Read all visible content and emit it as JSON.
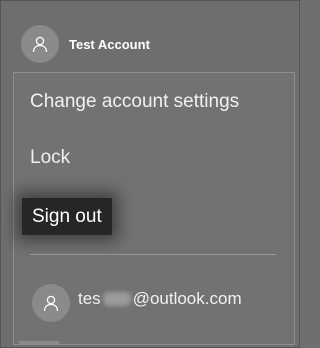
{
  "account": {
    "name": "Test Account",
    "avatar_icon": "person-icon"
  },
  "menu": {
    "items": [
      {
        "label": "Change account settings"
      },
      {
        "label": "Lock"
      },
      {
        "label": "Sign out",
        "highlighted": true
      }
    ]
  },
  "other_account": {
    "email_prefix": "tes",
    "email_suffix": "@outlook.com",
    "avatar_icon": "person-icon"
  },
  "colors": {
    "background": "#6f6f6f",
    "highlight": "#262626",
    "text": "#f1f1f1"
  }
}
